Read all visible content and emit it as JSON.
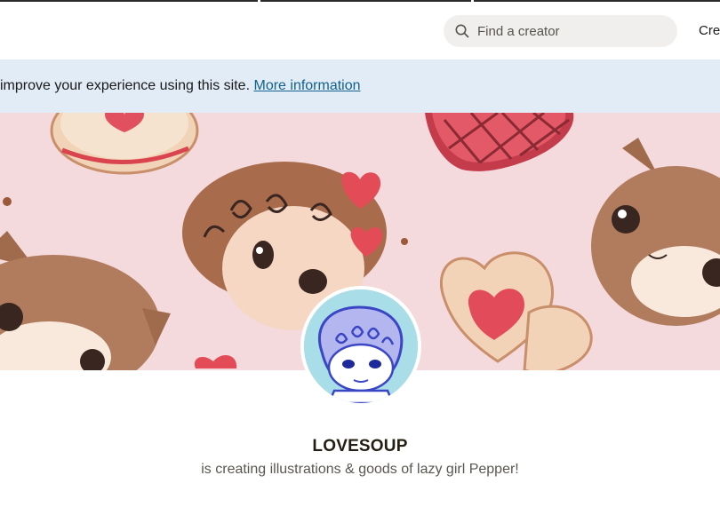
{
  "header": {
    "search": {
      "placeholder": "Find a creator",
      "icon": "search-icon"
    },
    "nav_create_label": "Crea"
  },
  "cookie_banner": {
    "text": "improve your experience using this site.",
    "link_label": "More information"
  },
  "profile": {
    "name": "LOVESOUP",
    "tagline": "is creating illustrations & goods of lazy girl Pepper!"
  },
  "colors": {
    "banner_bg": "#e1ecf6",
    "link": "#12618e",
    "cover_bg": "#f5dadd",
    "search_bg": "#f0efed",
    "avatar_bg": "#a9dde8",
    "text_primary": "#241e12",
    "text_secondary": "#5a5650"
  }
}
